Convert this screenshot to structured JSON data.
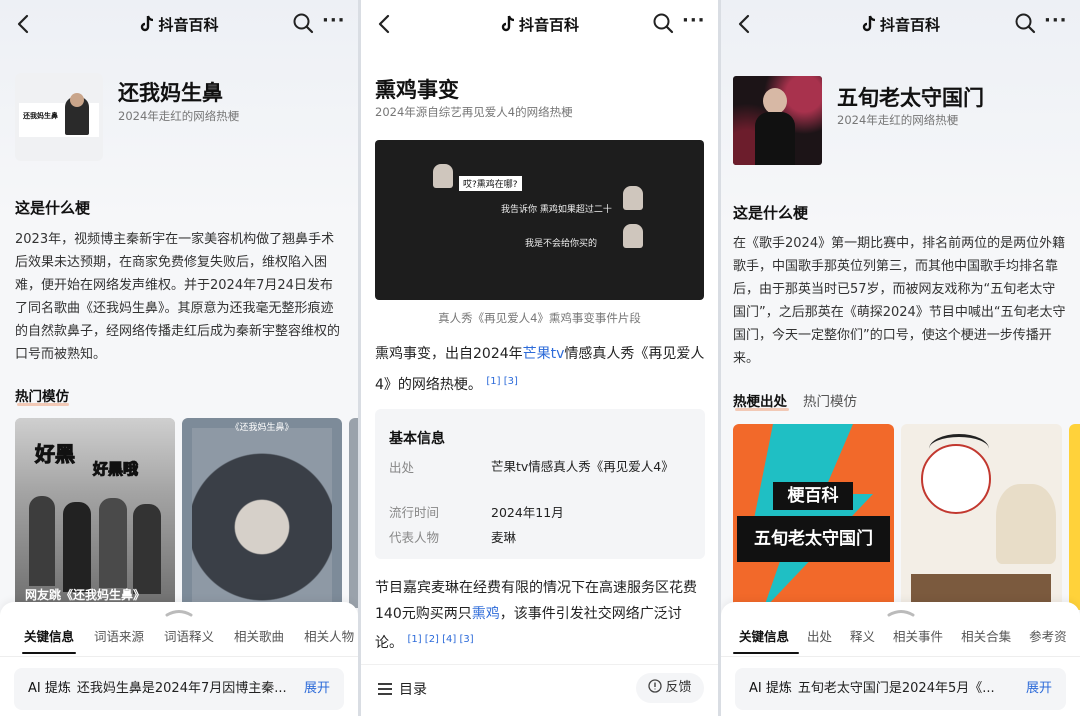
{
  "common": {
    "app_name": "抖音百科",
    "back_icon": "back-arrow-icon",
    "search_icon": "search-icon",
    "more_icon": "more-dots-icon",
    "more_glyph": "···",
    "accent_color": "#2d6bd9"
  },
  "panel1": {
    "title": "还我妈生鼻",
    "subtitle": "2024年走红的网络热梗",
    "thumb_caption": "还我妈生鼻",
    "section_title": "这是什么梗",
    "body": "2023年，视频博主秦新宇在一家美容机构做了翘鼻手术后效果未达预期，在商家免费修复失败后，维权陷入困难，便开始在网络发声维权。并于2024年7月24日发布了同名歌曲《还我妈生鼻》。其原意为还我毫无整形痕迹的自然款鼻子，经网络传播走红后成为秦新宇整容维权的口号而被熟知。",
    "hot_tab": "热门模仿",
    "card1_bubble1": "好黑",
    "card1_bubble2": "好黑哦",
    "card1_caption": "网友跳《还我妈生鼻》",
    "card2_top": "《还我妈生鼻》",
    "sheet_tabs": [
      "关键信息",
      "词语来源",
      "词语释义",
      "相关歌曲",
      "相关人物"
    ],
    "ai_label": "AI 提炼",
    "ai_text": "还我妈生鼻是2024年7月因博主秦...",
    "ai_expand": "展开"
  },
  "panel2": {
    "title": "熏鸡事变",
    "subtitle": "2024年源自综艺再见爱人4的网络热梗",
    "video_lines": [
      "哎?熏鸡在哪?",
      "我告诉你 熏鸡如果超过二十",
      "我是不会给你买的"
    ],
    "video_caption": "真人秀《再见爱人4》熏鸡事变事件片段",
    "intro_a": "熏鸡事变，出自2024年",
    "intro_link": "芒果tv",
    "intro_b": "情感真人秀《再见爱人4》的网络热梗。",
    "intro_refs": "[1] [3]",
    "info_title": "基本信息",
    "info_rows": [
      {
        "k": "出处",
        "v": "芒果tv情感真人秀《再见爱人4》"
      },
      {
        "k": "流行时间",
        "v": "2024年11月"
      },
      {
        "k": "代表人物",
        "v": "麦琳"
      }
    ],
    "para_a": "节目嘉宾麦琳在经费有限的情况下在高速服务区花费140元购买两只",
    "para_link": "熏鸡",
    "para_b": "，该事件引发社交网络广泛讨论。",
    "para_refs": "[1] [2] [4] [3]",
    "toc_label": "目录",
    "feedback_label": "反馈"
  },
  "panel3": {
    "title": "五旬老太守国门",
    "subtitle": "2024年走红的网络热梗",
    "section_title": "这是什么梗",
    "body": "在《歌手2024》第一期比赛中，排名前两位的是两位外籍歌手，中国歌手那英位列第三，而其他中国歌手均排名靠后，由于那英当时已57岁，而被网友戏称为“五旬老太守国门”，之后那英在《萌探2024》节目中喊出“五旬老太守国门，今天一定整你们”的口号，使这个梗进一步传播开来。",
    "tabs": [
      "热梗出处",
      "热门模仿"
    ],
    "card1_top": "梗百科",
    "card1_main": "五旬老太守国门",
    "sheet_tabs": [
      "关键信息",
      "出处",
      "释义",
      "相关事件",
      "相关合集",
      "参考资"
    ],
    "ai_label": "AI 提炼",
    "ai_text": "五旬老太守国门是2024年5月《...",
    "ai_expand": "展开"
  }
}
